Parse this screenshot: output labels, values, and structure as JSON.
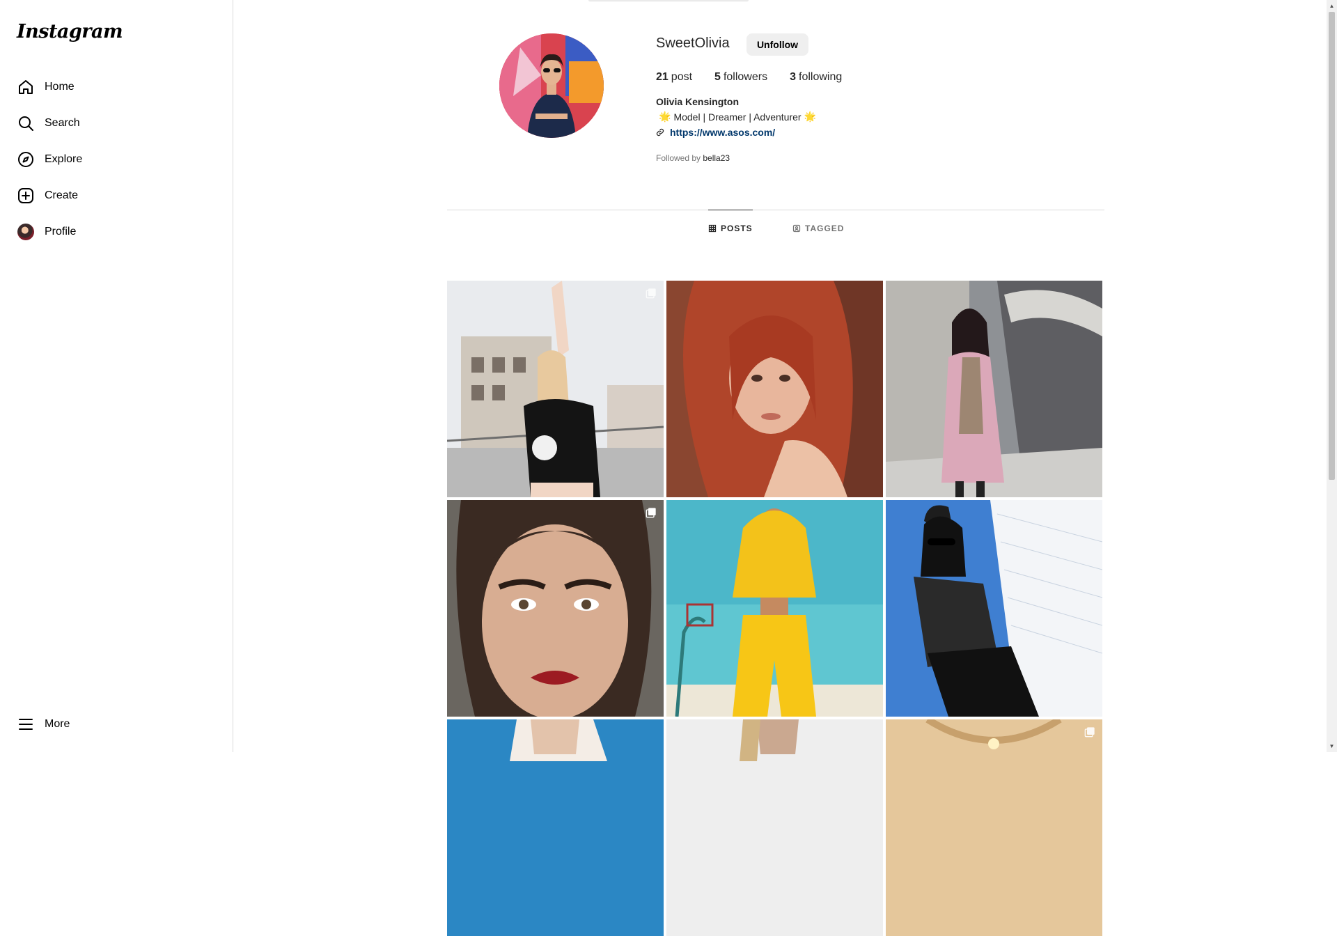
{
  "sidebar": {
    "logo": "Instagram",
    "items": [
      {
        "label": "Home",
        "icon": "home-icon"
      },
      {
        "label": "Search",
        "icon": "search-icon"
      },
      {
        "label": "Explore",
        "icon": "compass-icon"
      },
      {
        "label": "Create",
        "icon": "plus-square-icon"
      },
      {
        "label": "Profile",
        "icon": "avatar"
      }
    ],
    "more": "More"
  },
  "profile": {
    "username": "SweetOlivia",
    "unfollow_label": "Unfollow",
    "stats": {
      "posts_count": "21",
      "posts_label": "post",
      "followers_count": "5",
      "followers_label": "followers",
      "following_count": "3",
      "following_label": "following"
    },
    "full_name": "Olivia Kensington",
    "bio": "Model | Dreamer | Adventurer",
    "bio_emoji": "🌟",
    "link": "https://www.asos.com/",
    "followed_by_prefix": "Followed by",
    "followed_by_user": "bella23"
  },
  "tabs": [
    {
      "label": "POSTS",
      "active": true
    },
    {
      "label": "TAGGED",
      "active": false
    }
  ],
  "colors": {
    "border": "#dbdbdb",
    "button_bg": "#efefef",
    "muted_text": "#737373",
    "text": "#262626"
  },
  "posts": [
    {
      "multi": true
    },
    {
      "multi": false
    },
    {
      "multi": false
    },
    {
      "multi": true
    },
    {
      "multi": false
    },
    {
      "multi": false
    },
    {
      "multi": false
    },
    {
      "multi": false
    },
    {
      "multi": true
    }
  ]
}
